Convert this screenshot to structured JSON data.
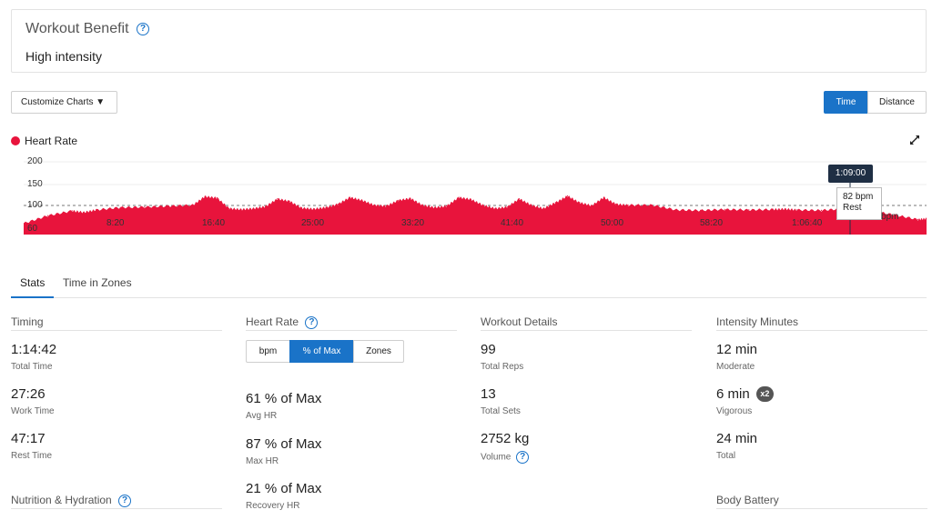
{
  "workout_benefit": {
    "title": "Workout Benefit",
    "value": "High intensity"
  },
  "toolbar": {
    "customize_label": "Customize Charts",
    "time_label": "Time",
    "distance_label": "Distance"
  },
  "chart_data": {
    "type": "area",
    "title": "Heart Rate",
    "series_color": "#e8143c",
    "y_ticks": [
      "200",
      "150",
      "100",
      "60"
    ],
    "ylim": [
      60,
      200
    ],
    "x_ticks": [
      "8:20",
      "16:40",
      "25:00",
      "33:20",
      "41:40",
      "50:00",
      "58:20",
      "1:06:40"
    ],
    "x_minutes": [
      0,
      2,
      4,
      5,
      6,
      8,
      10,
      12,
      14,
      15,
      16,
      17,
      18,
      19,
      20,
      21,
      22,
      23,
      24,
      25,
      26,
      27,
      28,
      29,
      30,
      31,
      32,
      33,
      34,
      35,
      36,
      37,
      38,
      39,
      40,
      41,
      42,
      43,
      44,
      45,
      46,
      47,
      48,
      49,
      50,
      52,
      54,
      56,
      58,
      60,
      62,
      63,
      64,
      66,
      68,
      69,
      70,
      72,
      74,
      74.7
    ],
    "bpm": [
      72,
      88,
      98,
      95,
      100,
      105,
      106,
      108,
      110,
      128,
      125,
      103,
      101,
      103,
      107,
      123,
      118,
      104,
      102,
      105,
      112,
      126,
      120,
      110,
      108,
      120,
      124,
      110,
      105,
      108,
      126,
      122,
      110,
      103,
      106,
      123,
      110,
      103,
      115,
      129,
      115,
      109,
      126,
      112,
      110,
      110,
      100,
      99,
      101,
      100,
      101,
      102,
      100,
      99,
      103,
      89,
      98,
      90,
      80,
      82
    ],
    "grid_line": 100,
    "tooltip": {
      "time": "1:09:00",
      "value": "82 bpm",
      "state": "Rest"
    },
    "unit": "bpm"
  },
  "tabs": {
    "stats": "Stats",
    "zones": "Time in Zones"
  },
  "timing": {
    "heading": "Timing",
    "total_time": "1:14:42",
    "total_time_label": "Total Time",
    "work_time": "27:26",
    "work_time_label": "Work Time",
    "rest_time": "47:17",
    "rest_time_label": "Rest Time"
  },
  "heart_rate": {
    "heading": "Heart Rate",
    "bpm_label": "bpm",
    "max_label": "% of Max",
    "zones_label": "Zones",
    "avg": "61 % of Max",
    "avg_label": "Avg HR",
    "max": "87 % of Max",
    "max_hr_label": "Max HR",
    "recovery": "21 % of Max",
    "recovery_label": "Recovery HR"
  },
  "workout_details": {
    "heading": "Workout Details",
    "reps": "99",
    "reps_label": "Total Reps",
    "sets": "13",
    "sets_label": "Total Sets",
    "volume": "2752 kg",
    "volume_label": "Volume"
  },
  "intensity": {
    "heading": "Intensity Minutes",
    "moderate": "12 min",
    "moderate_label": "Moderate",
    "vigorous": "6 min",
    "vigorous_badge": "x2",
    "vigorous_label": "Vigorous",
    "total": "24 min",
    "total_label": "Total"
  },
  "nutrition": {
    "heading": "Nutrition & Hydration"
  },
  "body_battery": {
    "heading": "Body Battery"
  }
}
